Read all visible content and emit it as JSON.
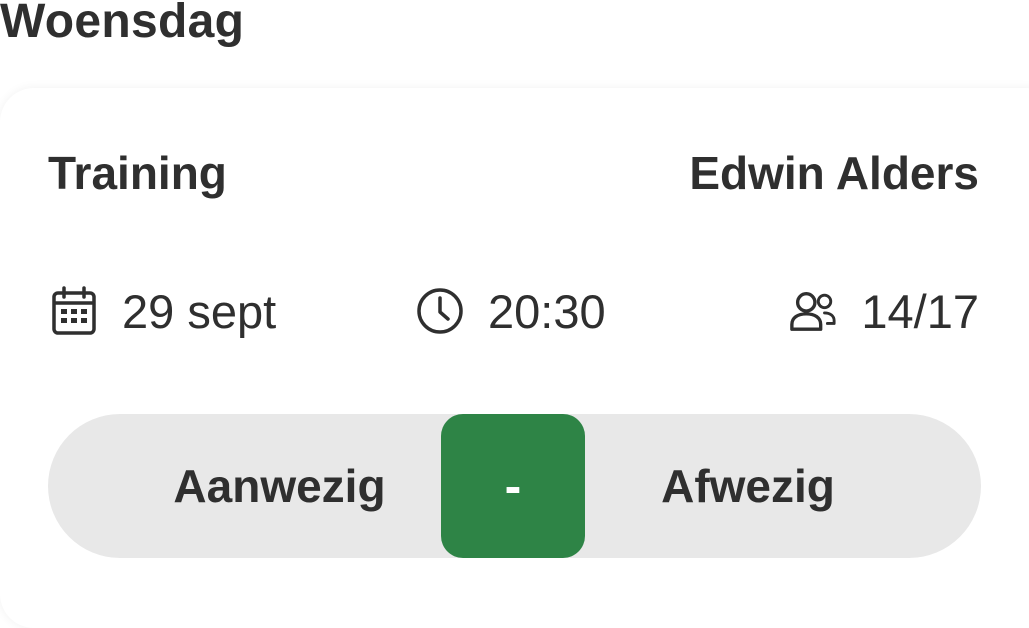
{
  "day": "Woensdag",
  "event": {
    "title": "Training",
    "trainer": "Edwin Alders",
    "date": "29 sept",
    "time": "20:30",
    "participants": "14/17"
  },
  "icons": {
    "date": "calendar-icon",
    "time": "clock-icon",
    "participants": "users-icon"
  },
  "attendance": {
    "present_label": "Aanwezig",
    "neutral_label": "-",
    "absent_label": "Afwezig",
    "selected": "-"
  },
  "colors": {
    "accent": "#2e8446",
    "toggle_bg": "#e8e8e8",
    "text": "#2f2f2f"
  }
}
